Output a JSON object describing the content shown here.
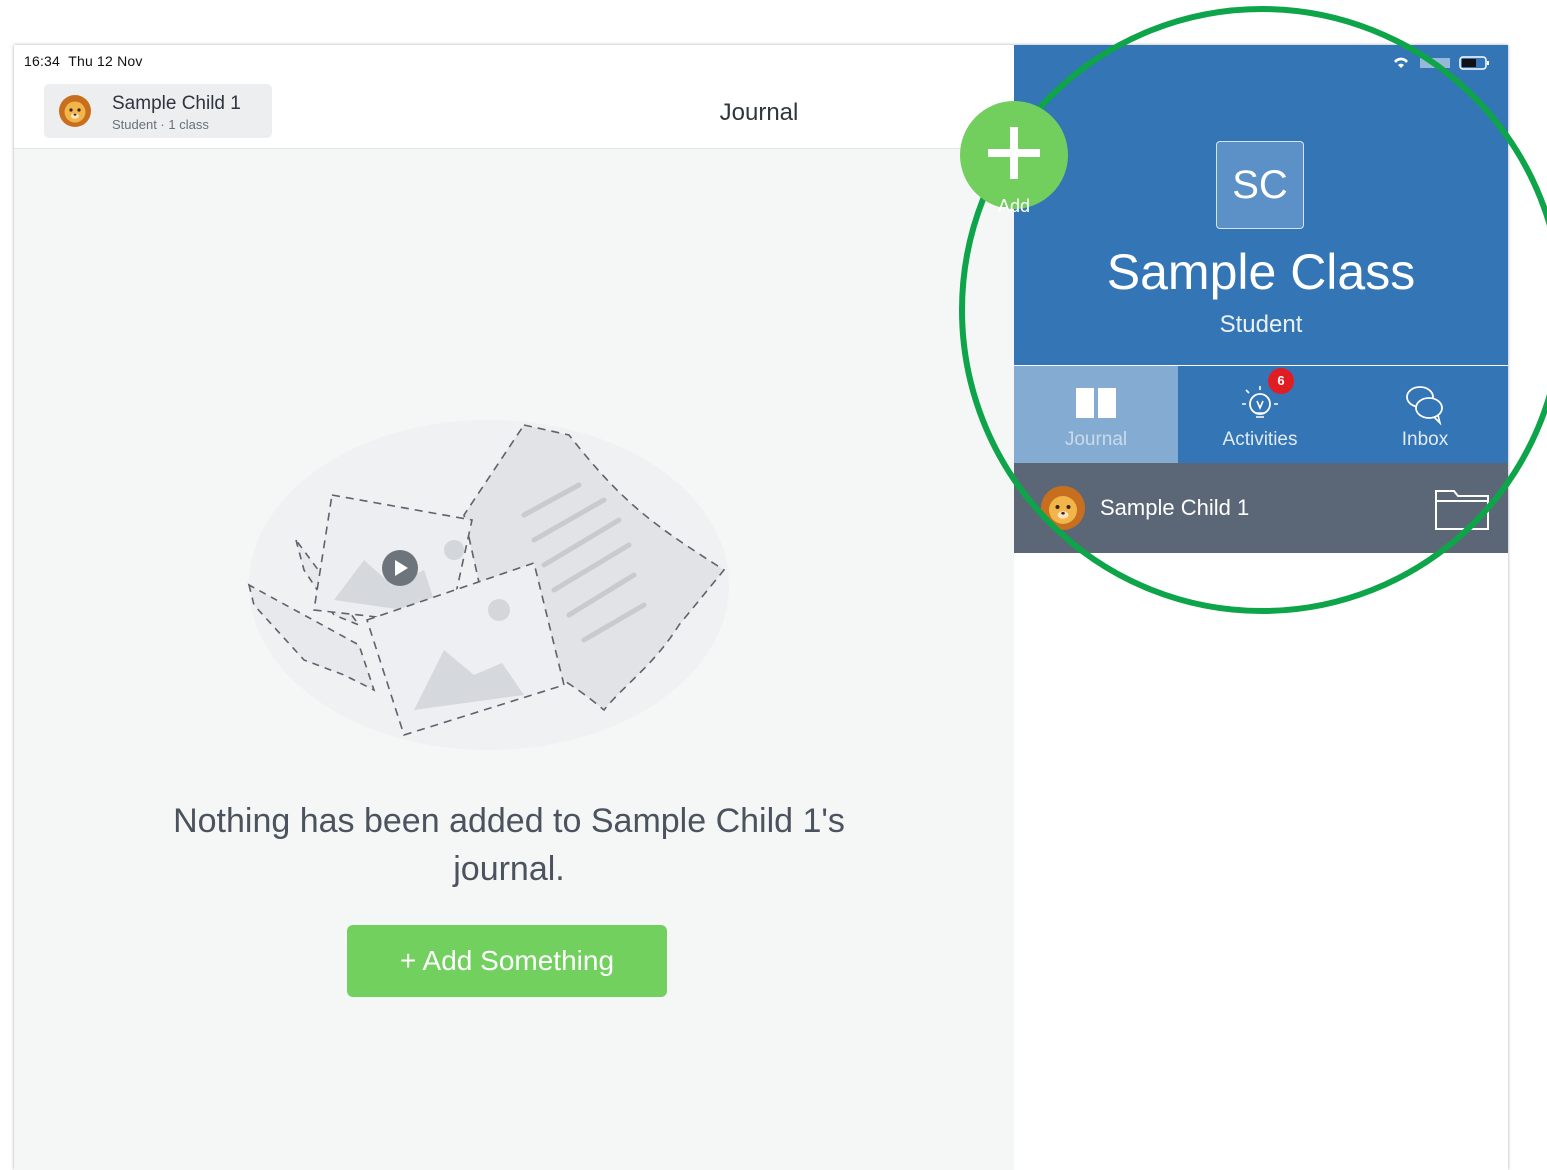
{
  "status_bar": {
    "time": "16:34",
    "date": "Thu 12 Nov",
    "battery": "58%"
  },
  "nav": {
    "child_name": "Sample Child 1",
    "child_subtitle": "Student · 1 class",
    "title": "Journal"
  },
  "fab": {
    "label": "Add",
    "icon": "plus-icon"
  },
  "empty_state": {
    "message": "Nothing has been added to Sample Child 1's journal.",
    "button_label": "+ Add Something"
  },
  "class_panel": {
    "avatar_initials": "SC",
    "class_name": "Sample Class",
    "role": "Student",
    "tabs": [
      {
        "label": "Journal",
        "icon": "book-icon",
        "active": true
      },
      {
        "label": "Activities",
        "icon": "lightbulb-icon",
        "badge": "6"
      },
      {
        "label": "Inbox",
        "icon": "chat-bubbles-icon"
      }
    ],
    "child_row": {
      "name": "Sample Child 1",
      "icon": "folder-icon"
    }
  },
  "colors": {
    "header_blue": "#3475b5",
    "active_tab": "#84acd3",
    "green_button": "#72d05f",
    "child_row": "#5b6776",
    "badge_red": "#e11d24",
    "highlight_ring": "#0ea44a"
  }
}
